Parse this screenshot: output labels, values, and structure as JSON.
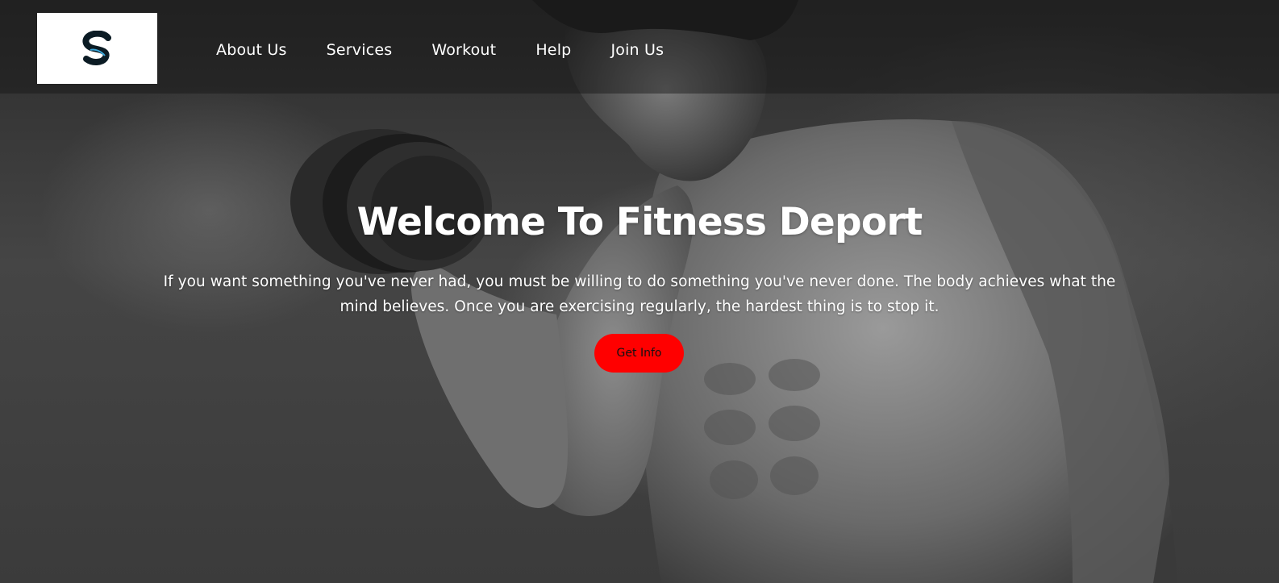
{
  "logo": {
    "letter": "S"
  },
  "nav": {
    "items": [
      {
        "label": "About Us"
      },
      {
        "label": "Services"
      },
      {
        "label": "Workout"
      },
      {
        "label": "Help"
      },
      {
        "label": "Join Us"
      }
    ]
  },
  "hero": {
    "title": "Welcome To Fitness Deport",
    "text": "If you want something you've never had, you must be willing to do something you've never done. The body achieves what the mind believes. Once you are exercising regularly, the hardest thing is to stop it.",
    "button_label": "Get Info",
    "button_color": "#ff0000",
    "image": "man-lifting-dumbbell-photo"
  }
}
